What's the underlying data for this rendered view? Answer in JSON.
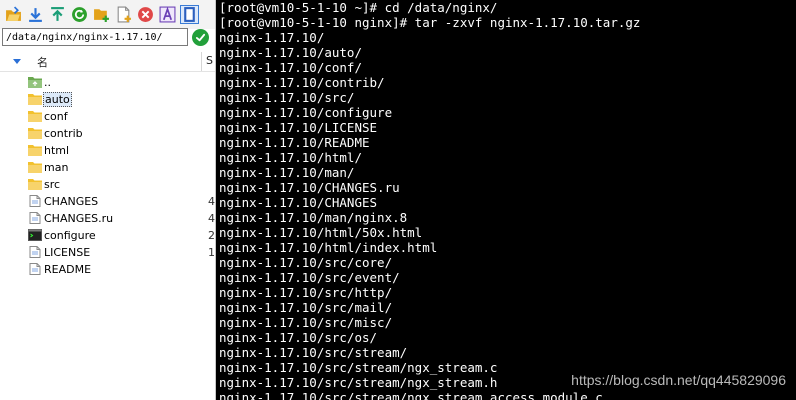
{
  "toolbar": {
    "buttons": [
      {
        "name": "open-folder-icon",
        "color": "#e3a21a"
      },
      {
        "name": "download-icon",
        "color": "#2b73d8"
      },
      {
        "name": "upload-icon",
        "color": "#1b9e77"
      },
      {
        "name": "refresh-icon",
        "color": "#2ca02c"
      },
      {
        "name": "new-folder-icon",
        "color": "#e3a21a"
      },
      {
        "name": "new-file-icon",
        "color": "#888888"
      },
      {
        "name": "delete-icon",
        "color": "#e04848"
      },
      {
        "name": "rename-icon",
        "color": "#6a3fb5"
      },
      {
        "name": "panel-toggle-icon",
        "color": "#2b5fbf"
      }
    ]
  },
  "path": {
    "value": "/data/nginx/nginx-1.17.10/"
  },
  "columns": {
    "name": "名",
    "size": "S"
  },
  "files": [
    {
      "name": "..",
      "type": "parent",
      "meta": ""
    },
    {
      "name": "auto",
      "type": "folder",
      "meta": "",
      "selected": true
    },
    {
      "name": "conf",
      "type": "folder",
      "meta": ""
    },
    {
      "name": "contrib",
      "type": "folder",
      "meta": ""
    },
    {
      "name": "html",
      "type": "folder",
      "meta": ""
    },
    {
      "name": "man",
      "type": "folder",
      "meta": ""
    },
    {
      "name": "src",
      "type": "folder",
      "meta": ""
    },
    {
      "name": "CHANGES",
      "type": "file",
      "meta": "4"
    },
    {
      "name": "CHANGES.ru",
      "type": "file",
      "meta": "4"
    },
    {
      "name": "configure",
      "type": "exec",
      "meta": "2"
    },
    {
      "name": "LICENSE",
      "type": "file",
      "meta": "1"
    },
    {
      "name": "README",
      "type": "file",
      "meta": ""
    }
  ],
  "terminal": {
    "lines": [
      "[root@vm10-5-1-10 ~]# cd /data/nginx/",
      "[root@vm10-5-1-10 nginx]# tar -zxvf nginx-1.17.10.tar.gz",
      "nginx-1.17.10/",
      "nginx-1.17.10/auto/",
      "nginx-1.17.10/conf/",
      "nginx-1.17.10/contrib/",
      "nginx-1.17.10/src/",
      "nginx-1.17.10/configure",
      "nginx-1.17.10/LICENSE",
      "nginx-1.17.10/README",
      "nginx-1.17.10/html/",
      "nginx-1.17.10/man/",
      "nginx-1.17.10/CHANGES.ru",
      "nginx-1.17.10/CHANGES",
      "nginx-1.17.10/man/nginx.8",
      "nginx-1.17.10/html/50x.html",
      "nginx-1.17.10/html/index.html",
      "nginx-1.17.10/src/core/",
      "nginx-1.17.10/src/event/",
      "nginx-1.17.10/src/http/",
      "nginx-1.17.10/src/mail/",
      "nginx-1.17.10/src/misc/",
      "nginx-1.17.10/src/os/",
      "nginx-1.17.10/src/stream/",
      "nginx-1.17.10/src/stream/ngx_stream.c",
      "nginx-1.17.10/src/stream/ngx_stream.h",
      "nginx-1.17.10/src/stream/ngx_stream_access_module.c"
    ],
    "watermark": "https://blog.csdn.net/qq445829096"
  },
  "colors": {
    "terminal_bg": "#000000",
    "terminal_fg": "#ffffff",
    "folder": "#f2c12e",
    "accent": "#2a6fd6",
    "go_button": "#22a03a"
  }
}
